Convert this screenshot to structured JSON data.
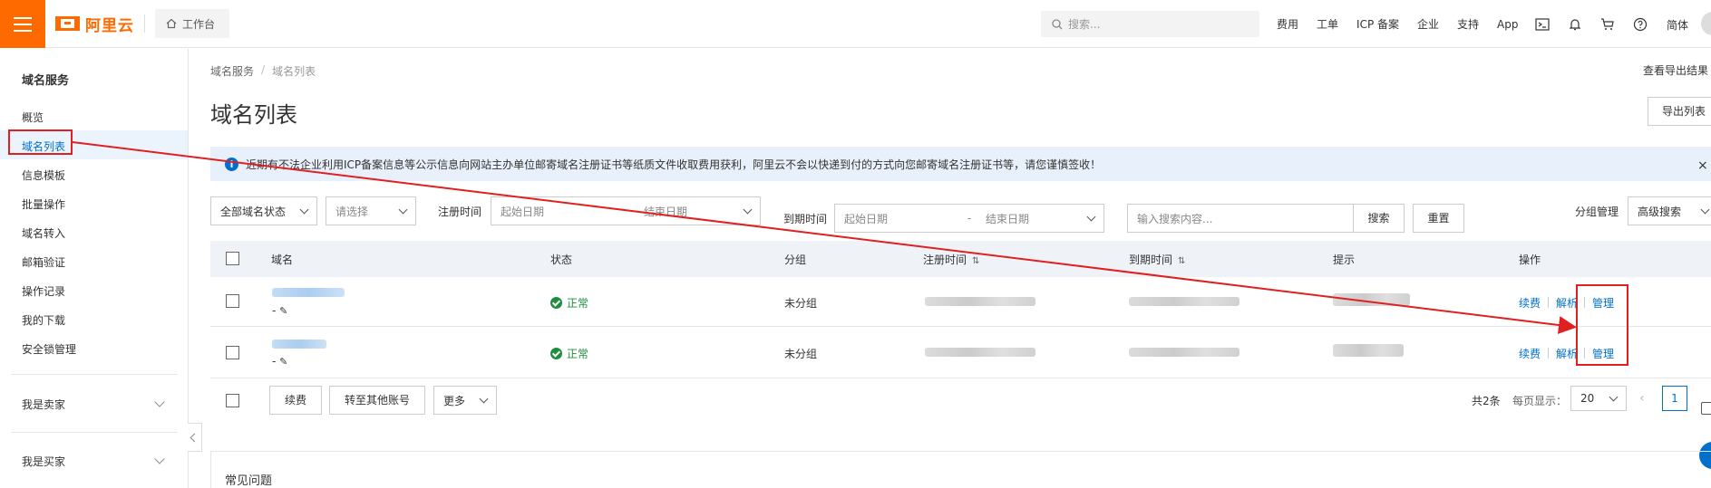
{
  "topbar": {
    "logo_text": "阿里云",
    "workbench": "工作台",
    "search_placeholder": "搜索...",
    "links": [
      "费用",
      "工单",
      "ICP 备案",
      "企业",
      "支持",
      "App"
    ],
    "lang": "简体",
    "accent": "#ff6a00"
  },
  "sidebar": {
    "title": "域名服务",
    "items": [
      "概览",
      "域名列表",
      "信息模板",
      "批量操作",
      "域名转入",
      "邮箱验证",
      "操作记录",
      "我的下载",
      "安全锁管理"
    ],
    "active_index": 1,
    "groups": [
      "我是卖家",
      "我是买家"
    ]
  },
  "breadcrumb": {
    "root": "域名服务",
    "sep": "/",
    "current": "域名列表"
  },
  "page": {
    "title": "域名列表",
    "export_result": "查看导出结果",
    "export_button": "导出列表"
  },
  "notice": {
    "text": "近期有不法企业利用ICP备案信息等公示信息向网站主办单位邮寄域名注册证书等纸质文件收取费用获利，阿里云不会以快递到付的方式向您邮寄域名注册证书等，请您谨慎签收！",
    "close": "×"
  },
  "filters": {
    "status_select": "全部域名状态",
    "type_select": "请选择",
    "reg_label": "注册时间",
    "reg_start": "起始日期",
    "reg_end": "结束日期",
    "exp_label": "到期时间",
    "exp_start": "起始日期",
    "exp_dash": "-",
    "exp_end": "结束日期",
    "search_placeholder": "输入搜索内容...",
    "search_btn": "搜索",
    "reset_btn": "重置",
    "group_manage": "分组管理",
    "advanced_search": "高级搜索"
  },
  "table": {
    "headers": [
      "域名",
      "状态",
      "分组",
      "注册时间",
      "到期时间",
      "提示",
      "操作"
    ],
    "rows": [
      {
        "domain_suffix": "-",
        "status": "正常",
        "group": "未分组",
        "ops": [
          "续费",
          "解析",
          "管理"
        ]
      },
      {
        "domain_suffix": "-",
        "status": "正常",
        "group": "未分组",
        "ops": [
          "续费",
          "解析",
          "管理"
        ]
      }
    ],
    "status_color": "#1e8e3e",
    "link_color": "#0070cc"
  },
  "bottom": {
    "renew_btn": "续费",
    "transfer_btn": "转至其他账号",
    "more_btn": "更多",
    "total": "共2条",
    "per_page_label": "每页显示：",
    "per_page_value": "20",
    "current_page": "1"
  },
  "faq": {
    "title": "常见问题"
  },
  "annotation_color": "#e02020"
}
